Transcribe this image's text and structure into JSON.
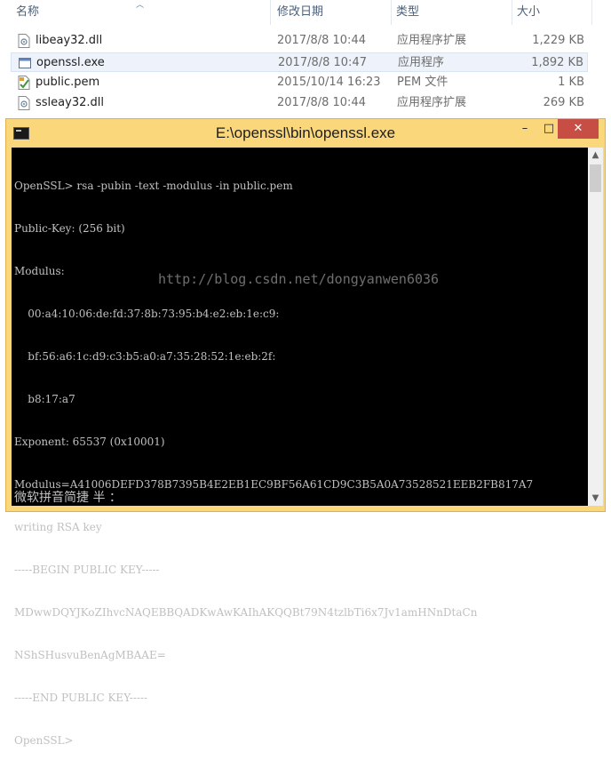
{
  "explorer": {
    "columns": {
      "name": "名称",
      "modified": "修改日期",
      "type": "类型",
      "size": "大小"
    },
    "files": [
      {
        "name": "libeay32.dll",
        "modified": "2017/8/8 10:44",
        "type": "应用程序扩展",
        "size": "1,229 KB",
        "icon": "dll-file-icon"
      },
      {
        "name": "openssl.exe",
        "modified": "2017/8/8 10:47",
        "type": "应用程序",
        "size": "1,892 KB",
        "icon": "exe-file-icon"
      },
      {
        "name": "public.pem",
        "modified": "2015/10/14 16:23",
        "type": "PEM 文件",
        "size": "1 KB",
        "icon": "pem-file-icon"
      },
      {
        "name": "ssleay32.dll",
        "modified": "2017/8/8 10:44",
        "type": "应用程序扩展",
        "size": "269 KB",
        "icon": "dll-file-icon"
      }
    ]
  },
  "console": {
    "title": "E:\\openssl\\bin\\openssl.exe",
    "buttons": {
      "minimize": "–",
      "maximize": "□",
      "close": "✕"
    },
    "lines": [
      "OpenSSL> rsa -pubin -text -modulus -in public.pem",
      "Public-Key: (256 bit)",
      "Modulus:",
      "    00:a4:10:06:de:fd:37:8b:73:95:b4:e2:eb:1e:c9:",
      "    bf:56:a6:1c:d9:c3:b5:a0:a7:35:28:52:1e:eb:2f:",
      "    b8:17:a7",
      "Exponent: 65537 (0x10001)",
      "Modulus=A41006DEFD378B7395B4E2EB1EC9BF56A61CD9C3B5A0A73528521EEB2FB817A7",
      "writing RSA key",
      "-----BEGIN PUBLIC KEY-----",
      "MDwwDQYJKoZIhvcNAQEBBQADKwAwKAIhAKQQBt79N4tzlbTi6x7Jv1amHNnDtaCn",
      "NShSHusvuBenAgMBAAE=",
      "-----END PUBLIC KEY-----",
      "OpenSSL>"
    ],
    "watermark": "http://blog.csdn.net/dongyanwen6036",
    "ime_status": "微软拼音简捷 半 ："
  }
}
